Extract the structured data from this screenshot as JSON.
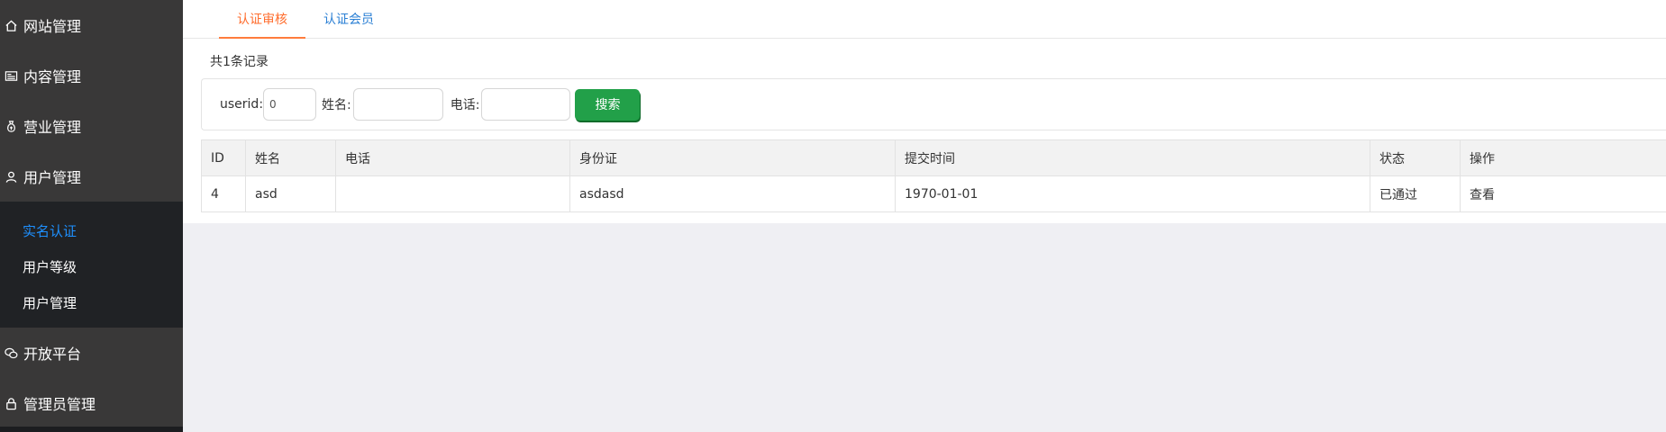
{
  "sidebar": {
    "groups": [
      {
        "label": "网站管理",
        "icon": "home-icon"
      },
      {
        "label": "内容管理",
        "icon": "image-icon"
      },
      {
        "label": "营业管理",
        "icon": "money-bag-icon"
      },
      {
        "label": "用户管理",
        "icon": "user-icon"
      },
      {
        "label": "开放平台",
        "icon": "wechat-icon"
      },
      {
        "label": "管理员管理",
        "icon": "lock-icon"
      }
    ],
    "user_submenu": [
      {
        "label": "实名认证",
        "active": true
      },
      {
        "label": "用户等级",
        "active": false
      },
      {
        "label": "用户管理",
        "active": false
      }
    ]
  },
  "tabs": [
    {
      "label": "认证审核",
      "active": true
    },
    {
      "label": "认证会员",
      "active": false
    }
  ],
  "record_count": "共1条记录",
  "search": {
    "userid_label": "userid:",
    "userid_value": "0",
    "name_label": "姓名:",
    "name_value": "",
    "phone_label": "电话:",
    "phone_value": "",
    "button_label": "搜索"
  },
  "table": {
    "headers": [
      "ID",
      "姓名",
      "电话",
      "身份证",
      "提交时间",
      "状态",
      "操作"
    ],
    "rows": [
      {
        "id": "4",
        "name": "asd",
        "phone": "",
        "idcard": "asdasd",
        "time": "1970-01-01",
        "status": "已通过",
        "action": "查看"
      }
    ]
  },
  "colors": {
    "sidebar_bg": "#393838",
    "submenu_bg": "#202225",
    "active_submenu": "#1e90ff",
    "active_tab": "#ff6c2c",
    "inactive_tab": "#2a7fd4",
    "search_button": "#22a049",
    "page_bg": "#efeff3"
  }
}
